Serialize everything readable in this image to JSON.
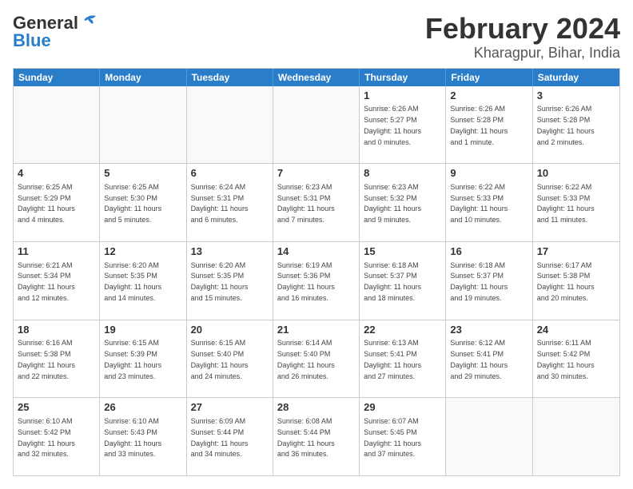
{
  "logo": {
    "general": "General",
    "blue": "Blue"
  },
  "title": "February 2024",
  "location": "Kharagpur, Bihar, India",
  "days": [
    "Sunday",
    "Monday",
    "Tuesday",
    "Wednesday",
    "Thursday",
    "Friday",
    "Saturday"
  ],
  "weeks": [
    [
      {
        "day": "",
        "content": ""
      },
      {
        "day": "",
        "content": ""
      },
      {
        "day": "",
        "content": ""
      },
      {
        "day": "",
        "content": ""
      },
      {
        "day": "1",
        "content": "Sunrise: 6:26 AM\nSunset: 5:27 PM\nDaylight: 11 hours\nand 0 minutes."
      },
      {
        "day": "2",
        "content": "Sunrise: 6:26 AM\nSunset: 5:28 PM\nDaylight: 11 hours\nand 1 minute."
      },
      {
        "day": "3",
        "content": "Sunrise: 6:26 AM\nSunset: 5:28 PM\nDaylight: 11 hours\nand 2 minutes."
      }
    ],
    [
      {
        "day": "4",
        "content": "Sunrise: 6:25 AM\nSunset: 5:29 PM\nDaylight: 11 hours\nand 4 minutes."
      },
      {
        "day": "5",
        "content": "Sunrise: 6:25 AM\nSunset: 5:30 PM\nDaylight: 11 hours\nand 5 minutes."
      },
      {
        "day": "6",
        "content": "Sunrise: 6:24 AM\nSunset: 5:31 PM\nDaylight: 11 hours\nand 6 minutes."
      },
      {
        "day": "7",
        "content": "Sunrise: 6:23 AM\nSunset: 5:31 PM\nDaylight: 11 hours\nand 7 minutes."
      },
      {
        "day": "8",
        "content": "Sunrise: 6:23 AM\nSunset: 5:32 PM\nDaylight: 11 hours\nand 9 minutes."
      },
      {
        "day": "9",
        "content": "Sunrise: 6:22 AM\nSunset: 5:33 PM\nDaylight: 11 hours\nand 10 minutes."
      },
      {
        "day": "10",
        "content": "Sunrise: 6:22 AM\nSunset: 5:33 PM\nDaylight: 11 hours\nand 11 minutes."
      }
    ],
    [
      {
        "day": "11",
        "content": "Sunrise: 6:21 AM\nSunset: 5:34 PM\nDaylight: 11 hours\nand 12 minutes."
      },
      {
        "day": "12",
        "content": "Sunrise: 6:20 AM\nSunset: 5:35 PM\nDaylight: 11 hours\nand 14 minutes."
      },
      {
        "day": "13",
        "content": "Sunrise: 6:20 AM\nSunset: 5:35 PM\nDaylight: 11 hours\nand 15 minutes."
      },
      {
        "day": "14",
        "content": "Sunrise: 6:19 AM\nSunset: 5:36 PM\nDaylight: 11 hours\nand 16 minutes."
      },
      {
        "day": "15",
        "content": "Sunrise: 6:18 AM\nSunset: 5:37 PM\nDaylight: 11 hours\nand 18 minutes."
      },
      {
        "day": "16",
        "content": "Sunrise: 6:18 AM\nSunset: 5:37 PM\nDaylight: 11 hours\nand 19 minutes."
      },
      {
        "day": "17",
        "content": "Sunrise: 6:17 AM\nSunset: 5:38 PM\nDaylight: 11 hours\nand 20 minutes."
      }
    ],
    [
      {
        "day": "18",
        "content": "Sunrise: 6:16 AM\nSunset: 5:38 PM\nDaylight: 11 hours\nand 22 minutes."
      },
      {
        "day": "19",
        "content": "Sunrise: 6:15 AM\nSunset: 5:39 PM\nDaylight: 11 hours\nand 23 minutes."
      },
      {
        "day": "20",
        "content": "Sunrise: 6:15 AM\nSunset: 5:40 PM\nDaylight: 11 hours\nand 24 minutes."
      },
      {
        "day": "21",
        "content": "Sunrise: 6:14 AM\nSunset: 5:40 PM\nDaylight: 11 hours\nand 26 minutes."
      },
      {
        "day": "22",
        "content": "Sunrise: 6:13 AM\nSunset: 5:41 PM\nDaylight: 11 hours\nand 27 minutes."
      },
      {
        "day": "23",
        "content": "Sunrise: 6:12 AM\nSunset: 5:41 PM\nDaylight: 11 hours\nand 29 minutes."
      },
      {
        "day": "24",
        "content": "Sunrise: 6:11 AM\nSunset: 5:42 PM\nDaylight: 11 hours\nand 30 minutes."
      }
    ],
    [
      {
        "day": "25",
        "content": "Sunrise: 6:10 AM\nSunset: 5:42 PM\nDaylight: 11 hours\nand 32 minutes."
      },
      {
        "day": "26",
        "content": "Sunrise: 6:10 AM\nSunset: 5:43 PM\nDaylight: 11 hours\nand 33 minutes."
      },
      {
        "day": "27",
        "content": "Sunrise: 6:09 AM\nSunset: 5:44 PM\nDaylight: 11 hours\nand 34 minutes."
      },
      {
        "day": "28",
        "content": "Sunrise: 6:08 AM\nSunset: 5:44 PM\nDaylight: 11 hours\nand 36 minutes."
      },
      {
        "day": "29",
        "content": "Sunrise: 6:07 AM\nSunset: 5:45 PM\nDaylight: 11 hours\nand 37 minutes."
      },
      {
        "day": "",
        "content": ""
      },
      {
        "day": "",
        "content": ""
      }
    ]
  ]
}
